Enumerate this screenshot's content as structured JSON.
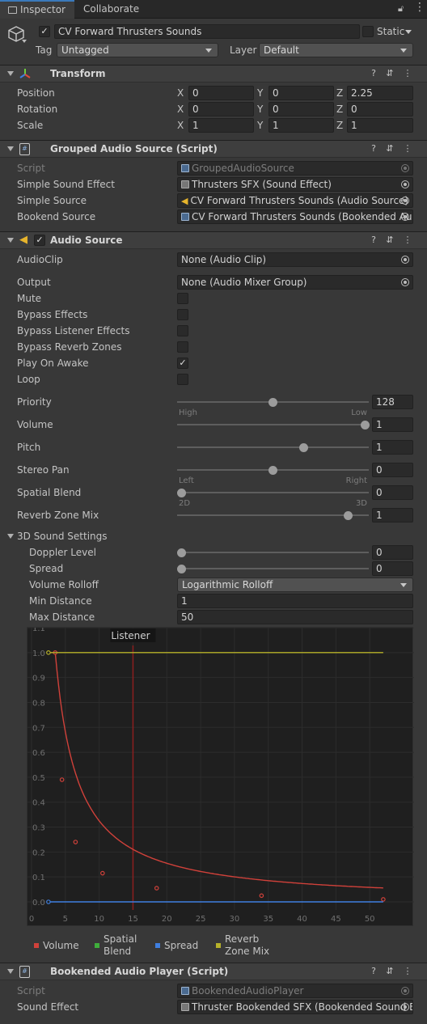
{
  "tabs": {
    "inspector": "Inspector",
    "collaborate": "Collaborate"
  },
  "object": {
    "name": "CV Forward Thrusters Sounds",
    "static_label": "Static",
    "tag_label": "Tag",
    "tag_value": "Untagged",
    "layer_label": "Layer",
    "layer_value": "Default"
  },
  "transform": {
    "title": "Transform",
    "position": {
      "label": "Position",
      "x": "0",
      "y": "0",
      "z": "2.25"
    },
    "rotation": {
      "label": "Rotation",
      "x": "0",
      "y": "0",
      "z": "0"
    },
    "scale": {
      "label": "Scale",
      "x": "1",
      "y": "1",
      "z": "1"
    },
    "axes": {
      "x": "X",
      "y": "Y",
      "z": "Z"
    }
  },
  "grouped": {
    "title": "Grouped Audio Source (Script)",
    "script_label": "Script",
    "script_value": "GroupedAudioSource",
    "simple_sound_effect_label": "Simple Sound Effect",
    "simple_sound_effect_value": "Thrusters SFX (Sound Effect)",
    "simple_source_label": "Simple Source",
    "simple_source_value": "CV Forward Thrusters Sounds (Audio Source)",
    "bookend_source_label": "Bookend Source",
    "bookend_source_value": "CV Forward Thrusters Sounds (Bookended Au"
  },
  "audio": {
    "title": "Audio Source",
    "audioclip_label": "AudioClip",
    "audioclip_value": "None (Audio Clip)",
    "output_label": "Output",
    "output_value": "None (Audio Mixer Group)",
    "mute_label": "Mute",
    "mute": false,
    "bypass_effects_label": "Bypass Effects",
    "bypass_effects": false,
    "bypass_listener_label": "Bypass Listener Effects",
    "bypass_listener": false,
    "bypass_reverb_label": "Bypass Reverb Zones",
    "bypass_reverb": false,
    "play_on_awake_label": "Play On Awake",
    "play_on_awake": true,
    "loop_label": "Loop",
    "loop": false,
    "priority": {
      "label": "Priority",
      "value": "128",
      "min": 0,
      "max": 256,
      "left": "High",
      "right": "Low"
    },
    "volume": {
      "label": "Volume",
      "value": "1",
      "min": 0,
      "max": 1
    },
    "pitch": {
      "label": "Pitch",
      "value": "1",
      "min": -3,
      "max": 3
    },
    "stereo_pan": {
      "label": "Stereo Pan",
      "value": "0",
      "min": -1,
      "max": 1,
      "left": "Left",
      "right": "Right"
    },
    "spatial_blend": {
      "label": "Spatial Blend",
      "value": "0",
      "min": 0,
      "max": 1,
      "left": "2D",
      "right": "3D"
    },
    "reverb_zone_mix": {
      "label": "Reverb Zone Mix",
      "value": "1",
      "min": 0,
      "max": 1.1
    },
    "sound3d": {
      "title": "3D Sound Settings",
      "doppler": {
        "label": "Doppler Level",
        "value": "0",
        "min": 0,
        "max": 5
      },
      "spread": {
        "label": "Spread",
        "value": "0",
        "min": 0,
        "max": 360
      },
      "rolloff_label": "Volume Rolloff",
      "rolloff_value": "Logarithmic Rolloff",
      "min_distance_label": "Min Distance",
      "min_distance_value": "1",
      "max_distance_label": "Max Distance",
      "max_distance_value": "50"
    }
  },
  "chart_data": {
    "type": "line",
    "listener_label": "Listener",
    "listener_x": 15,
    "xlim": [
      0,
      55
    ],
    "ylim": [
      0,
      1.1
    ],
    "xticks": [
      "0",
      "5",
      "10",
      "15",
      "20",
      "25",
      "30",
      "35",
      "40",
      "45",
      "50"
    ],
    "xtick_values": [
      0,
      5,
      10,
      15,
      20,
      25,
      30,
      35,
      40,
      45,
      50
    ],
    "yticks": [
      "0.0",
      "0.1",
      "0.2",
      "0.3",
      "0.4",
      "0.5",
      "0.6",
      "0.7",
      "0.8",
      "0.9",
      "1.0",
      "1.1"
    ],
    "ytick_values": [
      0,
      0.1,
      0.2,
      0.3,
      0.4,
      0.5,
      0.6,
      0.7,
      0.8,
      0.9,
      1.0,
      1.1
    ],
    "series": [
      {
        "name": "Volume",
        "color": "#d0413a",
        "x": [
          2.5,
          3.5,
          4.5,
          6.5,
          10.5,
          18.5,
          34,
          52
        ],
        "y": [
          1.0,
          1.0,
          0.49,
          0.24,
          0.115,
          0.055,
          0.025,
          0.01
        ],
        "key_x": [
          3.5,
          4.5,
          6.5,
          10.5,
          18.5,
          34,
          52
        ],
        "key_y": [
          1.0,
          0.49,
          0.24,
          0.115,
          0.055,
          0.025,
          0.01
        ]
      },
      {
        "name": "Spatial Blend",
        "color": "#3fae3b",
        "x": [],
        "y": []
      },
      {
        "name": "Spread",
        "color": "#3f7fe0",
        "x": [
          2.5,
          52
        ],
        "y": [
          0,
          0
        ]
      },
      {
        "name": "Reverb Zone Mix",
        "color": "#b7b22a",
        "x": [
          2.5,
          52
        ],
        "y": [
          1.0,
          1.0
        ]
      }
    ],
    "legend": [
      "Volume",
      "Spatial Blend",
      "Spread",
      "Reverb Zone Mix"
    ]
  },
  "legend_text": {
    "volume": "Volume",
    "spatial1": "Spatial",
    "spatial2": "Blend",
    "spread": "Spread",
    "reverb1": "Reverb",
    "reverb2": "Zone Mix"
  },
  "bookended": {
    "title": "Bookended Audio Player (Script)",
    "script_label": "Script",
    "script_value": "BookendedAudioPlayer",
    "sound_effect_label": "Sound Effect",
    "sound_effect_value": "Thruster Bookended SFX (Bookended Sound E"
  }
}
